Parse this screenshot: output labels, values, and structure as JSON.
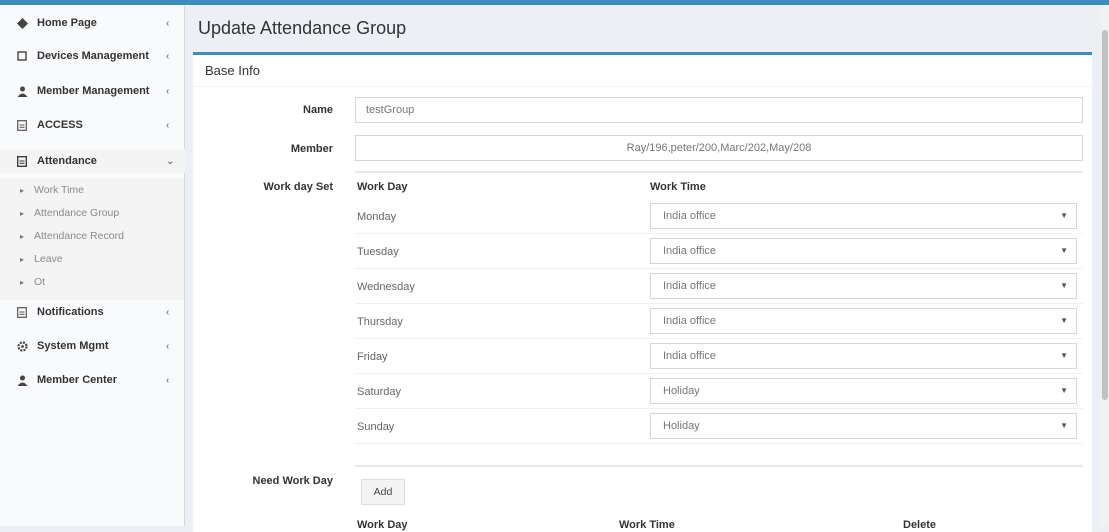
{
  "sidebar": {
    "items": [
      {
        "label": "Home Page",
        "icon": "dashboard-icon"
      },
      {
        "label": "Devices Management",
        "icon": "square-icon"
      },
      {
        "label": "Member Management",
        "icon": "user-icon"
      },
      {
        "label": "ACCESS",
        "icon": "file-icon"
      },
      {
        "label": "Attendance",
        "icon": "file-icon"
      },
      {
        "label": "Notifications",
        "icon": "file-icon"
      },
      {
        "label": "System Mgmt",
        "icon": "gear-icon"
      },
      {
        "label": "Member Center",
        "icon": "user-icon"
      }
    ],
    "submenu": [
      "Work Time",
      "Attendance Group",
      "Attendance Record",
      "Leave",
      "Ot"
    ]
  },
  "page": {
    "title": "Update Attendance Group",
    "box_title": "Base Info"
  },
  "form": {
    "name_label": "Name",
    "name_value": "testGroup",
    "member_label": "Member",
    "member_value": "Ray/196,peter/200,Marc/202,May/208",
    "workday_label": "Work day Set",
    "col_work_day": "Work Day",
    "col_work_time": "Work Time",
    "days": [
      {
        "day": "Monday",
        "time": "India office"
      },
      {
        "day": "Tuesday",
        "time": "India office"
      },
      {
        "day": "Wednesday",
        "time": "India office"
      },
      {
        "day": "Thursday",
        "time": "India office"
      },
      {
        "day": "Friday",
        "time": "India office"
      },
      {
        "day": "Saturday",
        "time": "Holiday"
      },
      {
        "day": "Sunday",
        "time": "Holiday"
      }
    ],
    "need_work_day_label": "Need Work Day",
    "add_label": "Add",
    "need_cols": {
      "work_day": "Work Day",
      "work_time": "Work Time",
      "delete": "Delete"
    }
  },
  "colors": {
    "accent": "#3c8dbc",
    "background": "#ecf0f5"
  }
}
